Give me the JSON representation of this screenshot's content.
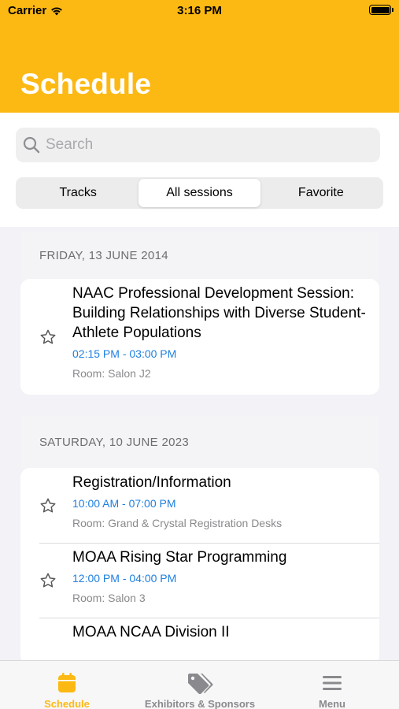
{
  "status_bar": {
    "carrier": "Carrier",
    "time": "3:16 PM"
  },
  "header": {
    "title": "Schedule",
    "color": "#fdb913"
  },
  "search": {
    "placeholder": "Search",
    "value": ""
  },
  "segments": [
    {
      "label": "Tracks",
      "selected": false
    },
    {
      "label": "All sessions",
      "selected": true
    },
    {
      "label": "Favorite",
      "selected": false
    }
  ],
  "sections": [
    {
      "date": "FRIDAY, 13 JUNE 2014",
      "sessions": [
        {
          "title": "NAAC Professional Development Session: Building Relationships with Diverse Student-Athlete Populations",
          "time": "02:15 PM - 03:00 PM",
          "room": "Room: Salon J2"
        }
      ]
    },
    {
      "date": "SATURDAY, 10 JUNE 2023",
      "sessions": [
        {
          "title": "Registration/Information",
          "time": "10:00 AM - 07:00 PM",
          "room": "Room: Grand & Crystal Registration Desks"
        },
        {
          "title": "MOAA Rising Star Programming",
          "time": "12:00 PM - 04:00 PM",
          "room": "Room: Salon 3"
        },
        {
          "title": "MOAA NCAA Division II",
          "time": "",
          "room": ""
        }
      ]
    }
  ],
  "tabbar": {
    "items": [
      {
        "label": "Schedule",
        "icon": "calendar-icon",
        "active": true
      },
      {
        "label": "Exhibitors & Sponsors",
        "icon": "tags-icon",
        "active": false
      },
      {
        "label": "Menu",
        "icon": "menu-icon",
        "active": false
      }
    ]
  },
  "colors": {
    "accent": "#fdb913",
    "time_text": "#1e7fe0"
  }
}
